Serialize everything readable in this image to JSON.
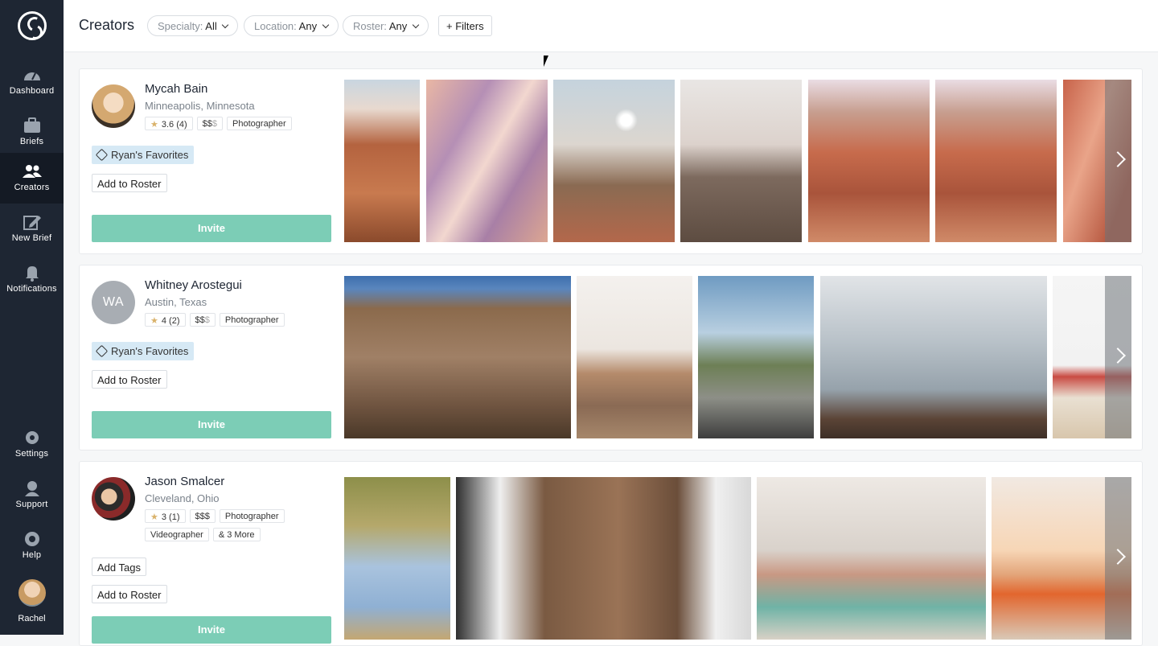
{
  "sidebar": {
    "items": [
      {
        "label": "Dashboard",
        "icon": "dashboard-gauge-icon",
        "active": false
      },
      {
        "label": "Briefs",
        "icon": "briefcase-icon",
        "active": false
      },
      {
        "label": "Creators",
        "icon": "people-icon",
        "active": true
      },
      {
        "label": "New Brief",
        "icon": "edit-icon",
        "active": false
      },
      {
        "label": "Notifications",
        "icon": "bell-icon",
        "active": false
      },
      {
        "label": "Settings",
        "icon": "gear-icon",
        "active": false
      },
      {
        "label": "Support",
        "icon": "headset-icon",
        "active": false
      },
      {
        "label": "Help",
        "icon": "lifebuoy-icon",
        "active": false
      }
    ],
    "user": "Rachel"
  },
  "header": {
    "title": "Creators",
    "filters": [
      {
        "label": "Specialty:",
        "value": "All"
      },
      {
        "label": "Location:",
        "value": "Any"
      },
      {
        "label": "Roster:",
        "value": "Any"
      }
    ],
    "more_filters": "+ Filters"
  },
  "creators": [
    {
      "name": "Mycah Bain",
      "location": "Minneapolis, Minnesota",
      "rating": "3.6 (4)",
      "price": "$$",
      "price_dim": "$",
      "specialties": [
        "Photographer"
      ],
      "tag": "Ryan's Favorites",
      "roster_button": "Add to Roster",
      "invite": "Invite"
    },
    {
      "name": "Whitney Arostegui",
      "initials": "WA",
      "location": "Austin, Texas",
      "rating": "4 (2)",
      "price": "$$",
      "price_dim": "$",
      "specialties": [
        "Photographer"
      ],
      "tag": "Ryan's Favorites",
      "roster_button": "Add to Roster",
      "invite": "Invite"
    },
    {
      "name": "Jason Smalcer",
      "location": "Cleveland, Ohio",
      "rating": "3 (1)",
      "price": "$$$",
      "price_dim": "",
      "specialties": [
        "Photographer",
        "Videographer",
        "& 3 More"
      ],
      "tags_button": "Add Tags",
      "roster_button": "Add to Roster",
      "invite": "Invite"
    }
  ],
  "colors": {
    "sidebar": "#1e2633",
    "invite": "#7ccdb6",
    "tag": "#d6e9f5"
  }
}
